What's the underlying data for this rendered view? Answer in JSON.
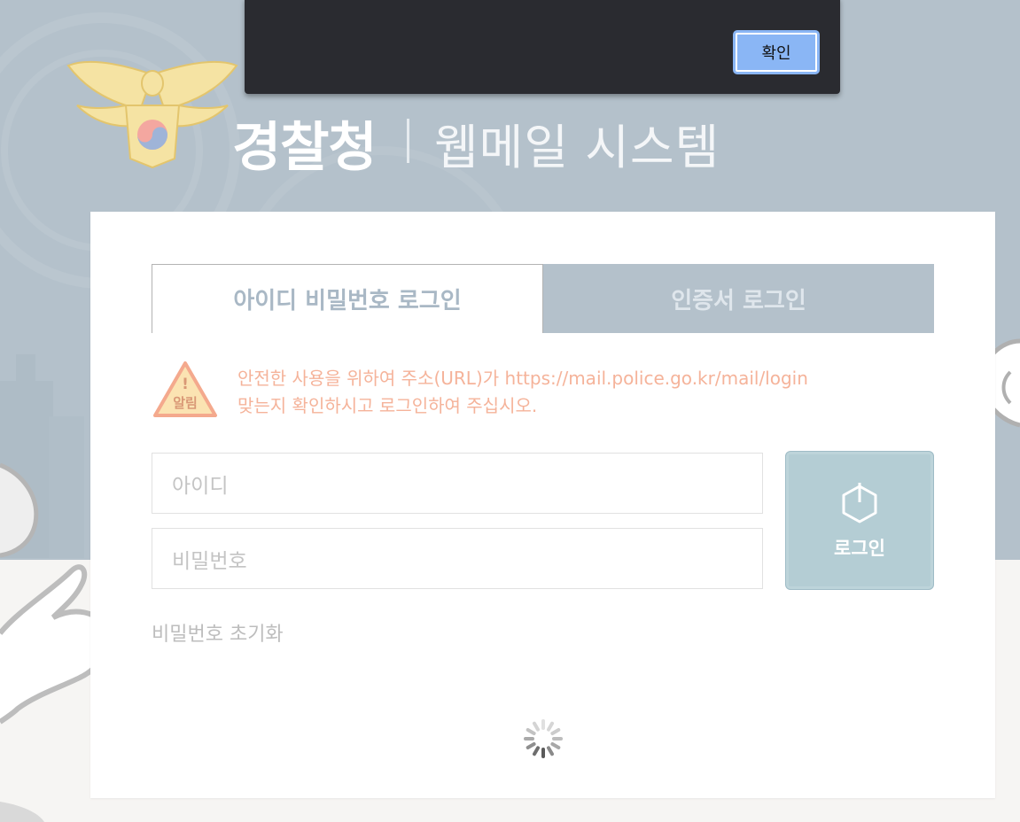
{
  "header": {
    "org": "경찰청",
    "system": "웹메일 시스템"
  },
  "tabs": [
    {
      "label": "아이디 비밀번호 로그인"
    },
    {
      "label": "인증서 로그인"
    }
  ],
  "notice": {
    "badge": "알림",
    "line1": "안전한 사용을 위하여 주소(URL)가 https://mail.police.go.kr/mail/login",
    "line2": "맞는지 확인하시고 로그인하여 주십시오."
  },
  "form": {
    "id_placeholder": "아이디",
    "password_placeholder": "비밀번호",
    "login_label": "로그인",
    "reset_label": "비밀번호 초기화"
  },
  "dialog": {
    "confirm_label": "확인"
  },
  "colors": {
    "top_background": "#b4c1cb",
    "card": "#ffffff",
    "notice_text": "#f5b39a",
    "login_button": "#b4cdd4",
    "dialog_background": "#2a2b30",
    "confirm_button": "#8ab6f5"
  },
  "icons": [
    "police-emblem-icon",
    "warning-icon",
    "power-icon",
    "loading-spinner-icon"
  ]
}
